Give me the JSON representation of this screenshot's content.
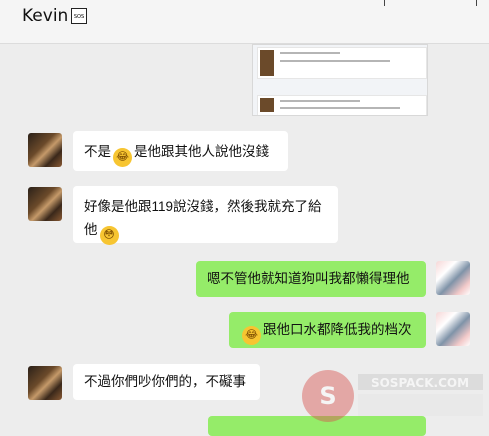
{
  "header": {
    "title": "Kevin",
    "badge": "SOS"
  },
  "messages": [
    {
      "side": "left",
      "text": [
        "不是",
        "是他跟其他人說他沒錢"
      ]
    },
    {
      "side": "left",
      "text": [
        "好像是他跟119說沒錢，然後我就充了給",
        "他"
      ]
    },
    {
      "side": "right",
      "text": "嗯不管他就知道狗叫我都懶得理他"
    },
    {
      "side": "right",
      "text": "跟他口水都降低我的档次"
    },
    {
      "side": "left",
      "text": "不過你們吵你們的，不礙事"
    }
  ],
  "watermark": "SOSPACK.COM"
}
